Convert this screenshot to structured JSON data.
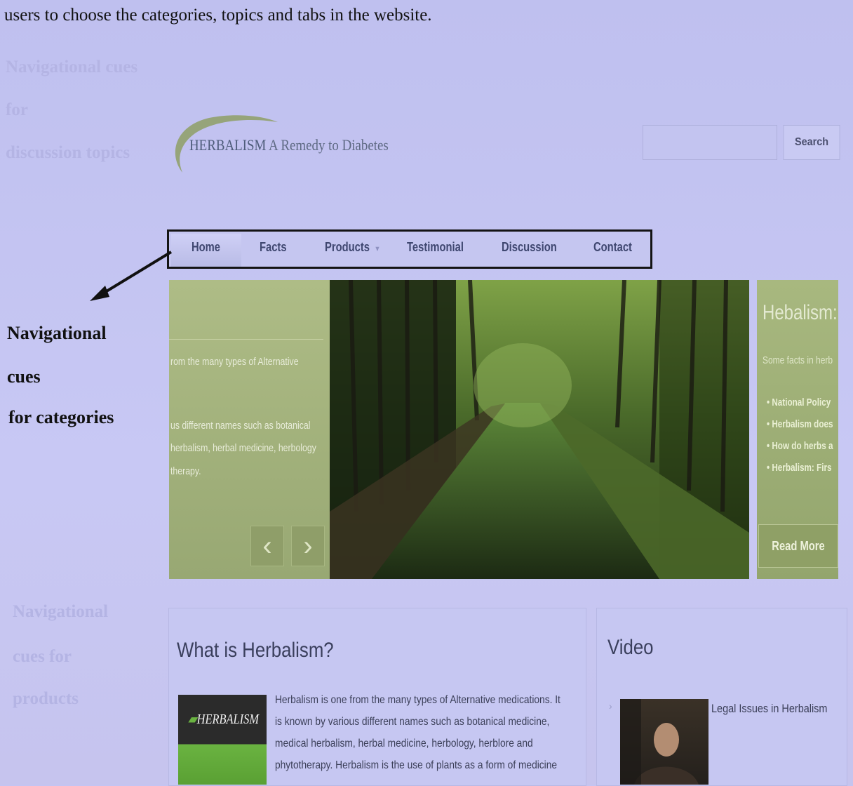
{
  "intro_text": "users to choose the categories, topics and tabs in the website.",
  "header": {
    "logo_brand": "HERBALISM",
    "logo_tagline": "A Remedy to Diabetes",
    "search_button": "Search"
  },
  "nav": {
    "items": [
      {
        "label": "Home"
      },
      {
        "label": "Facts"
      },
      {
        "label": "Products"
      },
      {
        "label": "Testimonial"
      },
      {
        "label": "Discussion"
      },
      {
        "label": "Contact"
      }
    ],
    "products_caret": "▼"
  },
  "slider": {
    "left_lines": [
      "rom the many types of Alternative",
      "us different names such as botanical",
      "herbalism, herbal medicine, herbology",
      "therapy."
    ],
    "prev_arrow": "‹",
    "next_arrow": "›",
    "right_title": "Hebalism: F",
    "right_subtitle": "Some facts in herb",
    "right_list": [
      "National Policy",
      "Herbalism does",
      "How do herbs a",
      "Herbalism: Firs"
    ],
    "read_more": "Read More"
  },
  "annotation": {
    "line1": "Navigational",
    "line2": "cues",
    "line3": "for categories"
  },
  "what_is": {
    "title": "What is Herbalism?",
    "book_label": "HERBALISM",
    "lines": [
      "Herbalism is one from the many types of Alternative medications. It",
      "is known by various different names such as botanical medicine,",
      "medical herbalism, herbal medicine, herbology, herblore and",
      "phytotherapy. Herbalism is the use of plants as a form of medicine"
    ]
  },
  "video": {
    "title": "Video",
    "item_title": "Legal Issues in Herbalism"
  },
  "colors": {
    "page_bg": "#c4c4f2",
    "nav_border": "#141414",
    "slider_panel": "#a3b37c"
  }
}
